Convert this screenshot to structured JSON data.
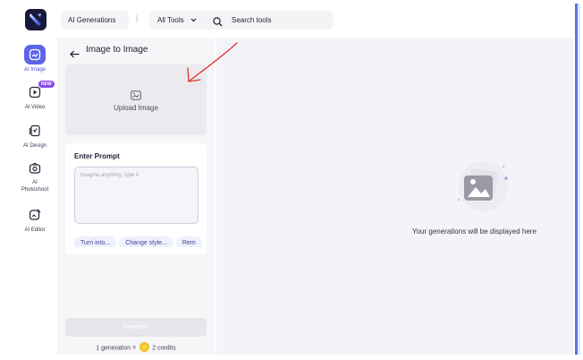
{
  "topbar": {
    "ai_generations_label": "AI Generations",
    "separator": "|",
    "all_tools_label": "All Tools",
    "search_placeholder": "Search tools"
  },
  "sidebar": {
    "items": [
      {
        "label": "AI Image",
        "active": true
      },
      {
        "label": "AI Video",
        "badge": "NEW"
      },
      {
        "label": "AI Design"
      },
      {
        "label": "AI",
        "label2": "Photoshoot"
      },
      {
        "label": "AI Editor"
      }
    ]
  },
  "panel": {
    "title": "Image to Image",
    "upload_label": "Upload Image",
    "prompt_title": "Enter Prompt",
    "prompt_placeholder": "Imagine anything, type it",
    "chips": [
      "Turn into...",
      "Change style...",
      "Rem"
    ],
    "generate_label": "Generate",
    "credits": {
      "generation_text": "1 generation =",
      "credits_text": "2 credits"
    }
  },
  "main": {
    "empty_text": "Your generations will be displayed here"
  },
  "colors": {
    "accent": "#5b64e9",
    "annotation": "#e0332f",
    "coin": "#f5c323"
  }
}
